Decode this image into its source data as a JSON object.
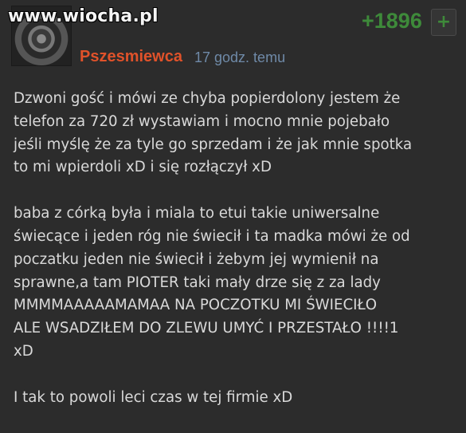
{
  "watermark": "www.wiocha.pl",
  "comment": {
    "author": "Pszesmiewca",
    "timestamp": "17 godz. temu",
    "votes": "+1896",
    "vote_button": "+",
    "paragraphs": [
      "Dzwoni gość i mówi ze chyba popierdolony jestem że\ntelefon za 720 zł wystawiam i mocno mnie pojebało\njeśli myślę że za tyle go sprzedam i że jak mnie spotka\nto mi wpierdoli xD i się rozłączył xD",
      "baba z córką była i miala to etui takie uniwersalne\nświecące i jeden róg nie świecił i ta madka mówi że od\npoczatku jeden nie świecił i żebym jej wymienił na\nsprawne,a tam PIOTER taki mały drze się z za lady\nMMMMAAAAAMAMAA NA POCZOTKU MI ŚWIECIŁO\nALE WSADZIŁEM DO ZLEWU UMYĆ I PRZESTAŁO !!!!1\nxD",
      "I tak to powoli leci czas w tej firmie xD"
    ]
  }
}
